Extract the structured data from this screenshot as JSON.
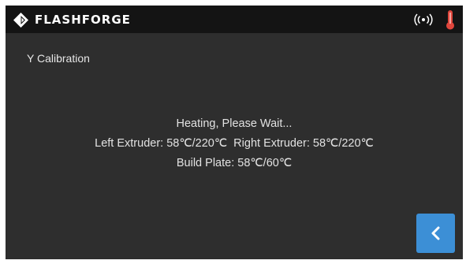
{
  "header": {
    "logo_text": "FLASHFORGE",
    "logo_icon": "flashforge-logo-icon",
    "wifi_icon": "wifi-signal-icon",
    "temperature_icon": "thermometer-icon"
  },
  "page": {
    "title": "Y Calibration"
  },
  "status": {
    "message": "Heating, Please Wait...",
    "extruders": "Left Extruder: 58℃/220℃  Right Extruder: 58℃/220℃",
    "build_plate": "Build Plate: 58℃/60℃"
  },
  "footer": {
    "back_icon": "chevron-left-icon"
  },
  "colors": {
    "background": "#2e2e2e",
    "header": "#141414",
    "accent": "#3c8fd6",
    "thermometer": "#e0463c"
  }
}
